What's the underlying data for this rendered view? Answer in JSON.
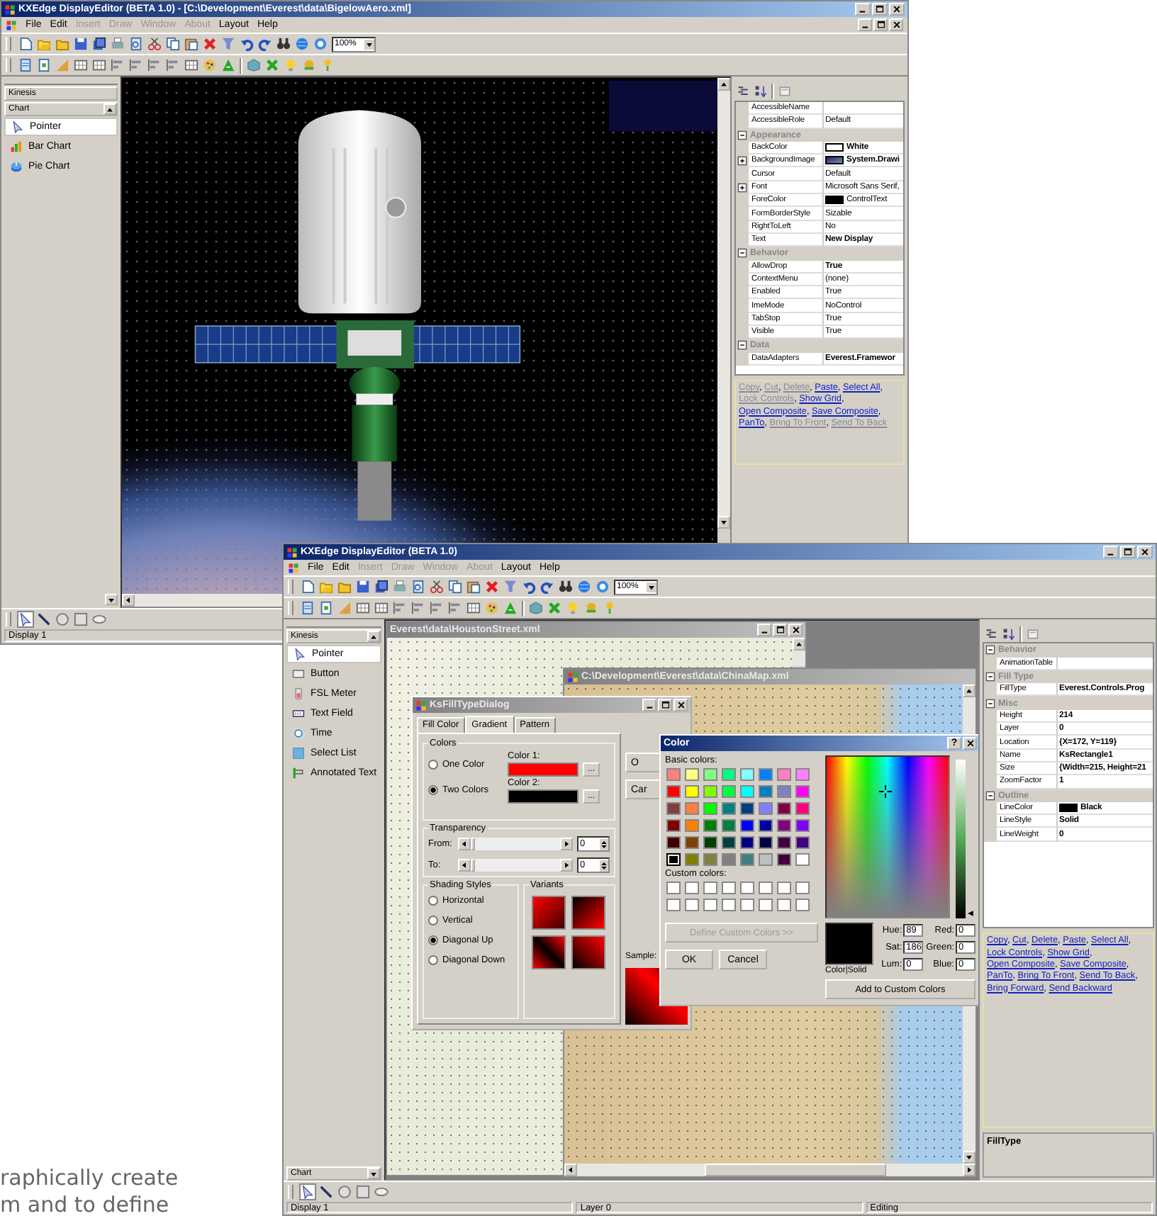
{
  "back_window": {
    "title": "KXEdge DisplayEditor (BETA 1.0) - [C:\\Development\\Everest\\data\\BigelowAero.xml]",
    "menu": [
      {
        "label": "File",
        "disabled": false
      },
      {
        "label": "Edit",
        "disabled": false
      },
      {
        "label": "Insert",
        "disabled": true
      },
      {
        "label": "Draw",
        "disabled": true
      },
      {
        "label": "Window",
        "disabled": true
      },
      {
        "label": "About",
        "disabled": true
      },
      {
        "label": "Layout",
        "disabled": false
      },
      {
        "label": "Help",
        "disabled": false
      }
    ],
    "zoom": "100%",
    "toolbox": {
      "header": "Kinesis",
      "group": "Chart",
      "items": [
        {
          "label": "Pointer",
          "kind": "pointer",
          "selected": true
        },
        {
          "label": "Bar Chart",
          "kind": "bars",
          "selected": false
        },
        {
          "label": "Pie Chart",
          "kind": "pie",
          "selected": false
        }
      ]
    },
    "properties": [
      {
        "kind": "property",
        "name": "AccessibleName"
      },
      {
        "kind": "property",
        "name": "AccessibleRole",
        "value": "Default",
        "bold": false
      },
      {
        "kind": "category",
        "name": "Appearance",
        "expanded": true
      },
      {
        "kind": "property",
        "name": "BackColor",
        "value": "White",
        "bold": true,
        "color": "#ffffff"
      },
      {
        "kind": "image-expandable",
        "name": "BackgroundImage",
        "value": "System.Drawi",
        "bold": true,
        "expanded": false
      },
      {
        "kind": "property",
        "name": "Cursor",
        "value": "Default",
        "bold": false
      },
      {
        "kind": "expandable",
        "name": "Font",
        "value": "Microsoft Sans Serif,",
        "bold": false,
        "expanded": false
      },
      {
        "kind": "property",
        "name": "ForeColor",
        "value": "ControlText",
        "bold": false,
        "color": "#000000"
      },
      {
        "kind": "property",
        "name": "FormBorderStyle",
        "value": "Sizable",
        "bold": false
      },
      {
        "kind": "property",
        "name": "RightToLeft",
        "value": "No",
        "bold": false
      },
      {
        "kind": "property",
        "name": "Text",
        "value": "New Display",
        "bold": true
      },
      {
        "kind": "category",
        "name": "Behavior",
        "expanded": true
      },
      {
        "kind": "property",
        "name": "AllowDrop",
        "value": "True",
        "bold": true
      },
      {
        "kind": "property",
        "name": "ContextMenu",
        "value": "(none)",
        "bold": false
      },
      {
        "kind": "property",
        "name": "Enabled",
        "value": "True",
        "bold": false
      },
      {
        "kind": "property",
        "name": "ImeMode",
        "value": "NoControl",
        "bold": false
      },
      {
        "kind": "property",
        "name": "TabStop",
        "value": "True",
        "bold": false
      },
      {
        "kind": "property",
        "name": "Visible",
        "value": "True",
        "bold": false
      },
      {
        "kind": "category",
        "name": "Data",
        "expanded": true
      },
      {
        "kind": "property",
        "name": "DataAdapters",
        "value": "Everest.Framewor",
        "bold": true
      }
    ],
    "separator": ", ",
    "commands": [
      {
        "label": "Copy",
        "disabled": true
      },
      {
        "label": "Cut",
        "disabled": true
      },
      {
        "label": "Delete",
        "disabled": true
      },
      {
        "label": "Paste",
        "disabled": false
      },
      {
        "label": "Select All",
        "disabled": false
      },
      {
        "label": "Lock Controls",
        "disabled": true
      },
      {
        "label": "Show Grid",
        "disabled": false
      },
      {
        "label": "Open Composite",
        "disabled": false
      },
      {
        "label": "Save Composite",
        "disabled": false
      },
      {
        "label": "PanTo",
        "disabled": false
      },
      {
        "label": "Bring To Front",
        "disabled": true
      },
      {
        "label": "Send To Back",
        "disabled": true
      }
    ],
    "status": [
      "Display 1"
    ]
  },
  "front_window": {
    "title": "KXEdge DisplayEditor (BETA 1.0)",
    "menu": [
      {
        "label": "File",
        "disabled": false
      },
      {
        "label": "Edit",
        "disabled": false
      },
      {
        "label": "Insert",
        "disabled": true
      },
      {
        "label": "Draw",
        "disabled": true
      },
      {
        "label": "Window",
        "disabled": true
      },
      {
        "label": "About",
        "disabled": true
      },
      {
        "label": "Layout",
        "disabled": false
      },
      {
        "label": "Help",
        "disabled": false
      }
    ],
    "zoom": "100%",
    "toolbox": {
      "header": "Kinesis",
      "group": "Chart",
      "items": [
        {
          "label": "Pointer",
          "kind": "pointer",
          "selected": true
        },
        {
          "label": "Button",
          "kind": "button",
          "selected": false
        },
        {
          "label": "FSL Meter",
          "kind": "meter",
          "selected": false
        },
        {
          "label": "Text Field",
          "kind": "textfield",
          "selected": false
        },
        {
          "label": "Time",
          "kind": "time",
          "selected": false
        },
        {
          "label": "Select List",
          "kind": "list",
          "selected": false
        },
        {
          "label": "Annotated Text",
          "kind": "flag",
          "selected": false
        }
      ]
    },
    "houston_window": {
      "title": "Everest\\data\\HoustonStreet.xml"
    },
    "china_window": {
      "title": "C:\\Development\\Everest\\data\\ChinaMap.xml"
    },
    "fill_dialog": {
      "title": "KsFillTypeDialog",
      "tabs": [
        {
          "label": "Fill Color",
          "selected": false
        },
        {
          "label": "Gradient",
          "selected": true
        },
        {
          "label": "Pattern",
          "selected": false
        }
      ],
      "colors_group": "Colors",
      "color_modes": [
        {
          "label": "One Color",
          "selected": false
        },
        {
          "label": "Two Colors",
          "selected": true
        }
      ],
      "colors": [
        {
          "label": "Color 1:",
          "color": "#ff0000",
          "button": "..."
        },
        {
          "label": "Color 2:",
          "color": "#000000",
          "button": "..."
        }
      ],
      "transparency_group": "Transparency",
      "transparency": [
        {
          "label": "From:",
          "level": 0,
          "value": "0"
        },
        {
          "label": "To:",
          "level": 0,
          "value": "0"
        }
      ],
      "shading_group": "Shading Styles",
      "shading": [
        {
          "label": "Horizontal",
          "selected": false
        },
        {
          "label": "Vertical",
          "selected": false
        },
        {
          "label": "Diagonal Up",
          "selected": true
        },
        {
          "label": "Diagonal Down",
          "selected": false
        }
      ],
      "variants_group": "Variants",
      "buttons": [
        "O",
        "Car"
      ],
      "sample_label": "Sample:"
    },
    "color_dialog": {
      "title": "Color",
      "help": "?",
      "basic_label": "Basic colors:",
      "basic_colors": [
        {
          "color": "#ff8080",
          "selected": false
        },
        {
          "color": "#ffff80",
          "selected": false
        },
        {
          "color": "#80ff80",
          "selected": false
        },
        {
          "color": "#00ff80",
          "selected": false
        },
        {
          "color": "#80ffff",
          "selected": false
        },
        {
          "color": "#0080ff",
          "selected": false
        },
        {
          "color": "#ff80c0",
          "selected": false
        },
        {
          "color": "#ff80ff",
          "selected": false
        },
        {
          "color": "#ff0000",
          "selected": false
        },
        {
          "color": "#ffff00",
          "selected": false
        },
        {
          "color": "#80ff00",
          "selected": false
        },
        {
          "color": "#00ff40",
          "selected": false
        },
        {
          "color": "#00ffff",
          "selected": false
        },
        {
          "color": "#0080c0",
          "selected": false
        },
        {
          "color": "#8080c0",
          "selected": false
        },
        {
          "color": "#ff00ff",
          "selected": false
        },
        {
          "color": "#804040",
          "selected": false
        },
        {
          "color": "#ff8040",
          "selected": false
        },
        {
          "color": "#00ff00",
          "selected": false
        },
        {
          "color": "#008080",
          "selected": false
        },
        {
          "color": "#004080",
          "selected": false
        },
        {
          "color": "#8080ff",
          "selected": false
        },
        {
          "color": "#800040",
          "selected": false
        },
        {
          "color": "#ff0080",
          "selected": false
        },
        {
          "color": "#800000",
          "selected": false
        },
        {
          "color": "#ff8000",
          "selected": false
        },
        {
          "color": "#008000",
          "selected": false
        },
        {
          "color": "#008040",
          "selected": false
        },
        {
          "color": "#0000ff",
          "selected": false
        },
        {
          "color": "#0000a0",
          "selected": false
        },
        {
          "color": "#800080",
          "selected": false
        },
        {
          "color": "#8000ff",
          "selected": false
        },
        {
          "color": "#400000",
          "selected": false
        },
        {
          "color": "#804000",
          "selected": false
        },
        {
          "color": "#004000",
          "selected": false
        },
        {
          "color": "#004040",
          "selected": false
        },
        {
          "color": "#000080",
          "selected": false
        },
        {
          "color": "#000040",
          "selected": false
        },
        {
          "color": "#400040",
          "selected": false
        },
        {
          "color": "#400080",
          "selected": false
        },
        {
          "color": "#000000",
          "selected": true
        },
        {
          "color": "#808000",
          "selected": false
        },
        {
          "color": "#808040",
          "selected": false
        },
        {
          "color": "#808080",
          "selected": false
        },
        {
          "color": "#408080",
          "selected": false
        },
        {
          "color": "#c0c0c0",
          "selected": false
        },
        {
          "color": "#400040",
          "selected": false
        },
        {
          "color": "#ffffff",
          "selected": false
        }
      ],
      "custom_label": "Custom colors:",
      "define_button": {
        "label": "Define Custom Colors >>",
        "disabled": true
      },
      "ok": "OK",
      "cancel": "Cancel",
      "solid_label": "Color|Solid",
      "fields": [
        {
          "label": "Hue:",
          "value": "89"
        },
        {
          "label": "Sat:",
          "value": "186"
        },
        {
          "label": "Lum:",
          "value": "0"
        },
        {
          "label": "Red:",
          "value": "0"
        },
        {
          "label": "Green:",
          "value": "0"
        },
        {
          "label": "Blue:",
          "value": "0"
        }
      ],
      "add_button": "Add to Custom Colors"
    },
    "properties": [
      {
        "kind": "category",
        "name": "Behavior",
        "expanded": true
      },
      {
        "kind": "property",
        "name": "AnimationTable"
      },
      {
        "kind": "category",
        "name": "Fill Type",
        "expanded": true
      },
      {
        "kind": "property",
        "name": "FillType",
        "value": "Everest.Controls.Prog",
        "bold": true
      },
      {
        "kind": "category",
        "name": "Misc",
        "expanded": true
      },
      {
        "kind": "property",
        "name": "Height",
        "value": "214",
        "bold": true
      },
      {
        "kind": "property",
        "name": "Layer",
        "value": "0",
        "bold": true
      },
      {
        "kind": "property",
        "name": "Location",
        "value": "{X=172, Y=119}",
        "bold": true
      },
      {
        "kind": "property",
        "name": "Name",
        "value": "KsRectangle1",
        "bold": true
      },
      {
        "kind": "property",
        "name": "Size",
        "value": "{Width=215, Height=21",
        "bold": true
      },
      {
        "kind": "property",
        "name": "ZoomFactor",
        "value": "1",
        "bold": true
      },
      {
        "kind": "category",
        "name": "Outline",
        "expanded": true
      },
      {
        "kind": "property",
        "name": "LineColor",
        "value": "Black",
        "bold": true,
        "color": "#000000"
      },
      {
        "kind": "property",
        "name": "LineStyle",
        "value": "Solid",
        "bold": true
      },
      {
        "kind": "property",
        "name": "LineWeight",
        "value": "0",
        "bold": true
      }
    ],
    "separator": ", ",
    "commands": [
      {
        "label": "Copy",
        "disabled": false
      },
      {
        "label": "Cut",
        "disabled": false
      },
      {
        "label": "Delete",
        "disabled": false
      },
      {
        "label": "Paste",
        "disabled": false
      },
      {
        "label": "Select All",
        "disabled": false
      },
      {
        "label": "Lock Controls",
        "disabled": false
      },
      {
        "label": "Show Grid",
        "disabled": false
      },
      {
        "label": "Open Composite",
        "disabled": false
      },
      {
        "label": "Save Composite",
        "disabled": false
      },
      {
        "label": "PanTo",
        "disabled": false
      },
      {
        "label": "Bring To Front",
        "disabled": false
      },
      {
        "label": "Send To Back",
        "disabled": false
      },
      {
        "label": "Bring Forward",
        "disabled": false
      },
      {
        "label": "Send Backward",
        "disabled": false
      }
    ],
    "description": "FillType",
    "status": [
      "Display 1",
      "Layer 0",
      "Editing"
    ]
  },
  "caption": [
    "raphically create",
    "m and to define"
  ]
}
